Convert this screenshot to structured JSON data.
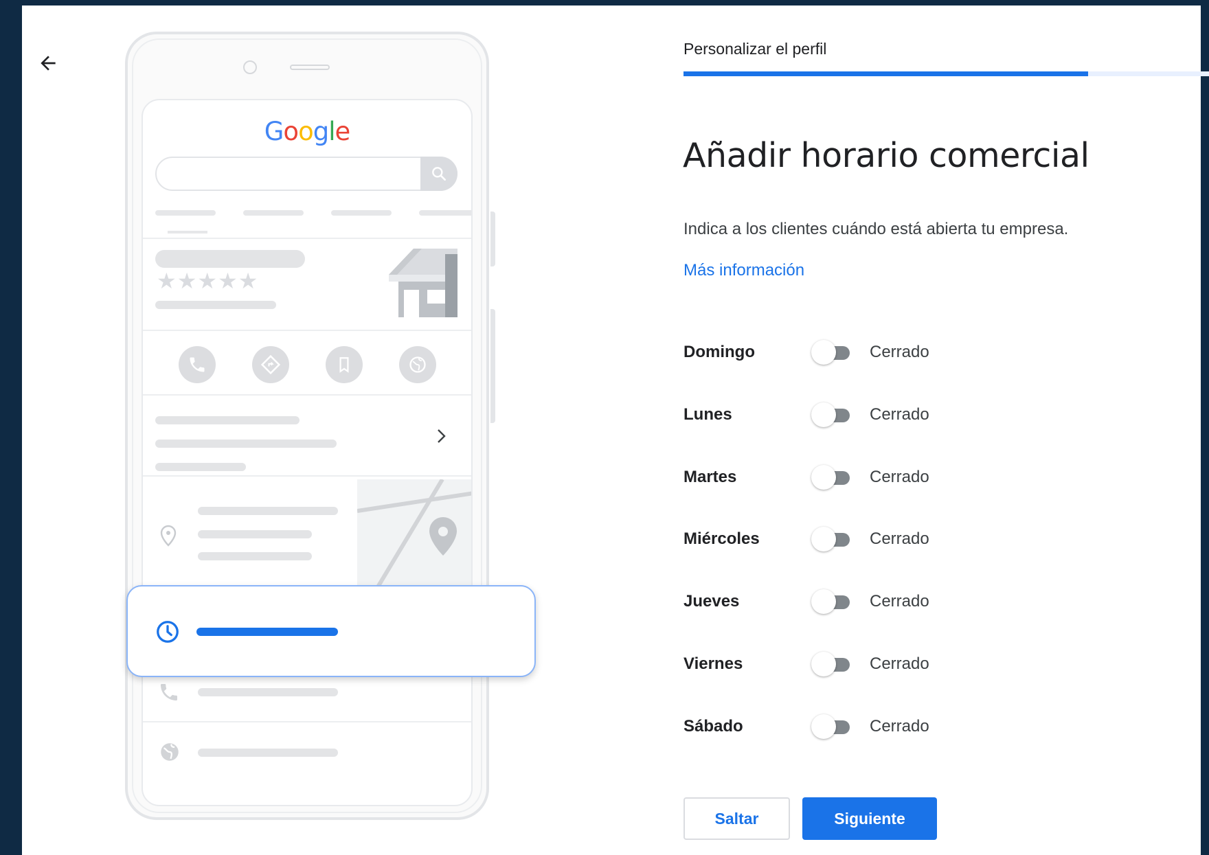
{
  "header": {
    "step_title": "Personalizar el perfil",
    "progress_fraction": 0.75
  },
  "main": {
    "heading": "Añadir horario comercial",
    "description": "Indica a los clientes cuándo está abierta tu empresa.",
    "more_info_link": "Más información"
  },
  "days": [
    {
      "name": "Domingo",
      "status": "Cerrado",
      "open": false
    },
    {
      "name": "Lunes",
      "status": "Cerrado",
      "open": false
    },
    {
      "name": "Martes",
      "status": "Cerrado",
      "open": false
    },
    {
      "name": "Miércoles",
      "status": "Cerrado",
      "open": false
    },
    {
      "name": "Jueves",
      "status": "Cerrado",
      "open": false
    },
    {
      "name": "Viernes",
      "status": "Cerrado",
      "open": false
    },
    {
      "name": "Sábado",
      "status": "Cerrado",
      "open": false
    }
  ],
  "actions": {
    "skip_label": "Saltar",
    "next_label": "Siguiente"
  },
  "illustration": {
    "logo_text": "Google",
    "star_rating_shown": 5
  },
  "icons": {
    "back": "arrow-left-icon",
    "search": "search-icon",
    "clock": "clock-icon"
  },
  "colors": {
    "accent": "#1a73e8",
    "background": "#0f2a44",
    "toggle_off": "#80868b"
  }
}
